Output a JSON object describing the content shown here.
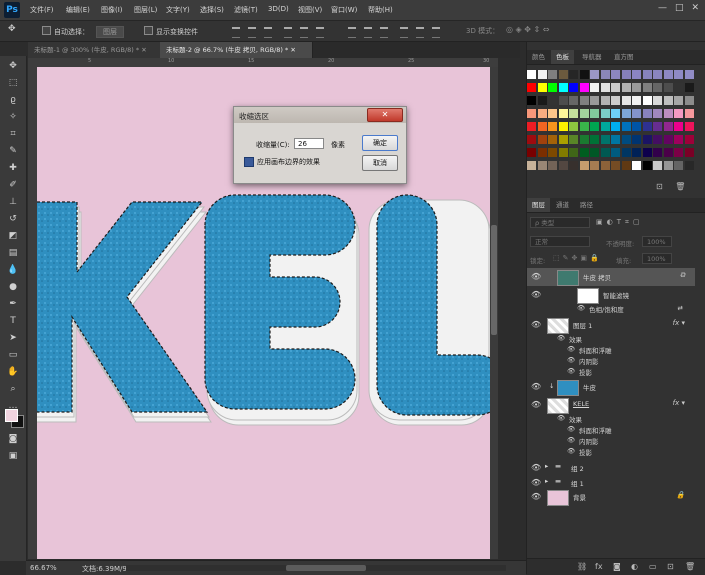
{
  "app": {
    "logo": "Ps"
  },
  "menu": [
    "文件(F)",
    "编辑(E)",
    "图像(I)",
    "图层(L)",
    "文字(Y)",
    "选择(S)",
    "滤镜(T)",
    "3D(D)",
    "视图(V)",
    "窗口(W)",
    "帮助(H)"
  ],
  "options": {
    "auto_select_label": "自动选择：",
    "auto_select_value": "图层",
    "show_transform_label": "显示变换控件",
    "mode_3d_label": "3D 模式："
  },
  "tabs": [
    {
      "label": "未标题-1 @ 300% (牛皮, RGB/8) *",
      "active": false
    },
    {
      "label": "未标题-2 @ 66.7% (牛皮 拷贝, RGB/8) *",
      "active": true
    }
  ],
  "ruler_labels": [
    "5",
    "10",
    "15",
    "20",
    "25",
    "30"
  ],
  "canvas": {
    "background": "#e8c4d8",
    "text": "KEL",
    "text_color": "#2f8fc0"
  },
  "dialog": {
    "title": "收缩选区",
    "close": "✕",
    "amount_label": "收缩量(C):",
    "amount_value": "26",
    "amount_unit": "像素",
    "apply_label": "应用画布边界的效果",
    "ok_label": "确定",
    "cancel_label": "取消"
  },
  "status": {
    "zoom": "66.67%",
    "doc": "文档:6.39M/98.8M"
  },
  "top_panel": {
    "tabs": [
      "颜色",
      "色板",
      "导航器",
      "直方图"
    ],
    "active_tab": "色板"
  },
  "swatch_colors": [
    "#ffffff",
    "#f2f2f2",
    "#7f7f7f",
    "#6b5a3e",
    "#262626",
    "#111111",
    "#9a96c6",
    "#8a86b8",
    "#8c86c0",
    "#8680ba",
    "#8b84c2",
    "#8783bd",
    "#8a85c0",
    "#8d88c3",
    "#8f8ac5",
    "#918cc6",
    "#ff0000",
    "#ffff00",
    "#00ff00",
    "#00ffff",
    "#0000ff",
    "#ff00ff",
    "#f2f2f2",
    "#e0e0e0",
    "#cccccc",
    "#b3b3b3",
    "#999999",
    "#808080",
    "#666666",
    "#4d4d4d",
    "#333333",
    "#1a1a1a",
    "#000000",
    "#1a1a1a",
    "#333333",
    "#4d4d4d",
    "#666666",
    "#808080",
    "#999999",
    "#b3b3b3",
    "#cccccc",
    "#e6e6e6",
    "#f2f2f2",
    "#ffffff",
    "#d9d9d9",
    "#bfbfbf",
    "#a6a6a6",
    "#8c8c8c",
    "#f7977a",
    "#f9ad81",
    "#fdc68a",
    "#fff79a",
    "#c4df9b",
    "#a3d39c",
    "#82ca9d",
    "#7bcdc8",
    "#6ecff6",
    "#7ea7d8",
    "#8493ca",
    "#8882be",
    "#a187be",
    "#bc8dbf",
    "#f49ac2",
    "#f6989d",
    "#ed1c24",
    "#f26522",
    "#f7941d",
    "#fff200",
    "#8dc63f",
    "#39b54a",
    "#00a651",
    "#00a99d",
    "#00aeef",
    "#0072bc",
    "#0054a6",
    "#2e3192",
    "#662d91",
    "#92278f",
    "#ec008c",
    "#ed145b",
    "#9e0b0f",
    "#a0410d",
    "#a36209",
    "#aba000",
    "#598527",
    "#1a7b30",
    "#007236",
    "#00746b",
    "#0076a3",
    "#004b80",
    "#003471",
    "#1b1464",
    "#440e62",
    "#630460",
    "#9e005d",
    "#9e0039",
    "#790000",
    "#7b2e00",
    "#7d4900",
    "#827b00",
    "#406618",
    "#005e20",
    "#005826",
    "#005952",
    "#005b7f",
    "#003663",
    "#002157",
    "#0d004c",
    "#32004b",
    "#4b0049",
    "#7b0046",
    "#7a0026",
    "#c7b299",
    "#998675",
    "#736357",
    "#534741",
    "#37302d",
    "#c69c6d",
    "#a67c52",
    "#8c6239",
    "#754c24",
    "#603913",
    "#ffffff",
    "#000000",
    "#c8c8c8",
    "#959595",
    "#646464",
    "#282828"
  ],
  "layers_panel": {
    "tabs": [
      "图层",
      "通道",
      "路径"
    ],
    "active_tab": "图层",
    "filter_placeholder": "ρ 类型",
    "blend_mode": "正常",
    "opacity_label": "不透明度:",
    "opacity_value": "100%",
    "lock_label": "锁定:",
    "fill_label": "填充:",
    "fill_value": "100%"
  },
  "layers": [
    {
      "name": "牛皮 拷贝",
      "selected": true,
      "fx": false
    },
    {
      "name": "智能滤镜",
      "selected": false,
      "fx": false
    },
    {
      "name": "色相/饱和度",
      "selected": false,
      "fx": false
    },
    {
      "name": "图层 1",
      "selected": false,
      "fx": true
    },
    {
      "name": "效果",
      "selected": false,
      "fx": false
    },
    {
      "name": "斜面和浮雕",
      "selected": false,
      "fx": false
    },
    {
      "name": "内阴影",
      "selected": false,
      "fx": false
    },
    {
      "name": "投影",
      "selected": false,
      "fx": false
    },
    {
      "name": "牛皮",
      "selected": false,
      "fx": false
    },
    {
      "name": "KELE",
      "selected": false,
      "fx": true
    },
    {
      "name": "效果",
      "selected": false,
      "fx": false
    },
    {
      "name": "斜面和浮雕",
      "selected": false,
      "fx": false
    },
    {
      "name": "内阴影",
      "selected": false,
      "fx": false
    },
    {
      "name": "投影",
      "selected": false,
      "fx": false
    },
    {
      "name": "组 2",
      "selected": false,
      "fx": false
    },
    {
      "name": "组 1",
      "selected": false,
      "fx": false
    },
    {
      "name": "背景",
      "selected": false,
      "fx": false
    }
  ],
  "layer_footer_icons": [
    "link-icon",
    "fx-icon",
    "mask-icon",
    "adjustment-icon",
    "folder-icon",
    "new-layer-icon",
    "trash-icon"
  ],
  "tools": [
    "move",
    "marquee",
    "lasso",
    "magic-wand",
    "crop",
    "eyedropper",
    "healing",
    "brush",
    "stamp",
    "history-brush",
    "eraser",
    "gradient",
    "blur",
    "dodge",
    "pen",
    "type",
    "path-select",
    "shape",
    "hand",
    "zoom",
    "more"
  ]
}
